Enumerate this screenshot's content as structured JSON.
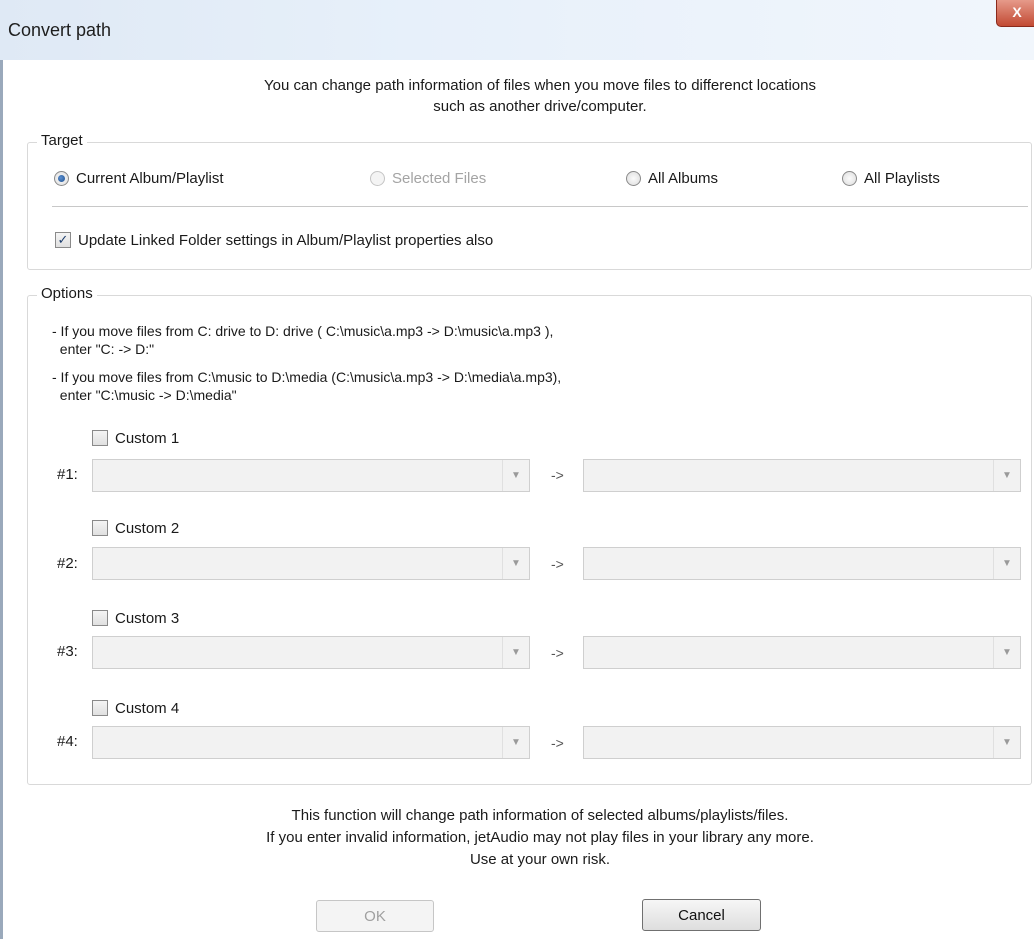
{
  "window": {
    "title": "Convert path",
    "close_label": "X"
  },
  "intro": {
    "line1": "You can change path information of files when you move files to differenct locations",
    "line2": "such as another drive/computer."
  },
  "target": {
    "title": "Target",
    "radios": [
      {
        "label": "Current Album/Playlist",
        "checked": true,
        "disabled": false
      },
      {
        "label": "Selected Files",
        "checked": false,
        "disabled": true
      },
      {
        "label": "All Albums",
        "checked": false,
        "disabled": false
      },
      {
        "label": "All Playlists",
        "checked": false,
        "disabled": false
      }
    ],
    "update_linked": {
      "label": "Update Linked Folder settings in Album/Playlist properties also",
      "checked": true
    }
  },
  "options": {
    "title": "Options",
    "lines": [
      "- If you move files from C: drive to D: drive ( C:\\music\\a.mp3 -> D:\\music\\a.mp3 ),",
      "  enter \"C: -> D:\"",
      "- If you move files from C:\\music to D:\\media (C:\\music\\a.mp3 -> D:\\media\\a.mp3),",
      "  enter \"C:\\music -> D:\\media\""
    ],
    "separator": "->",
    "customs": [
      {
        "checkbox_label": "Custom 1",
        "row_label": "#1:",
        "checked": false,
        "from_value": "",
        "to_value": ""
      },
      {
        "checkbox_label": "Custom 2",
        "row_label": "#2:",
        "checked": false,
        "from_value": "",
        "to_value": ""
      },
      {
        "checkbox_label": "Custom 3",
        "row_label": "#3:",
        "checked": false,
        "from_value": "",
        "to_value": ""
      },
      {
        "checkbox_label": "Custom 4",
        "row_label": "#4:",
        "checked": false,
        "from_value": "",
        "to_value": ""
      }
    ]
  },
  "warning": {
    "line1": "This function will change path information of selected albums/playlists/files.",
    "line2": "If you enter invalid information, jetAudio may not play files in your library any more.",
    "line3": "Use at your own risk."
  },
  "buttons": {
    "ok_label": "OK",
    "ok_disabled": true,
    "cancel_label": "Cancel"
  }
}
